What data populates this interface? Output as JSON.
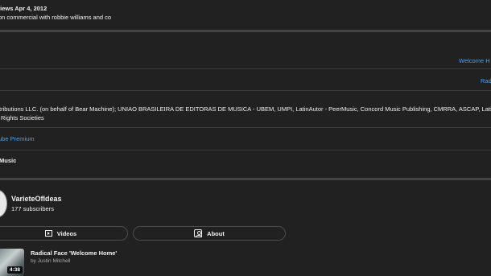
{
  "video": {
    "views_date": "views  Apr 4, 2012",
    "description": "on commercial with robbie williams and co"
  },
  "music": {
    "song_link": "Welcome H",
    "artist_link": "Rad",
    "licenses_line1": "tributions LLC. (on behalf of Bear Machine); UNIAO BRASILEIRA DE EDITORAS DE MUSICA - UBEM, UMPI, LatinAutor - PeerMusic, Concord Music Publishing, CMRRA, ASCAP, LatinAutor",
    "licenses_line2": "Rights Societies",
    "premium_link": "ube Premium",
    "music_label": "Music"
  },
  "channel": {
    "name": "VarieteOfIdeas",
    "subscribers": "177 subscribers",
    "videos_label": "Videos",
    "about_label": "About"
  },
  "related": {
    "title": "Radical Face 'Welcome Home'",
    "byline": "by Justin Mitchell",
    "duration": "4:38"
  },
  "icons": [
    "play-box-icon",
    "person-box-icon"
  ]
}
